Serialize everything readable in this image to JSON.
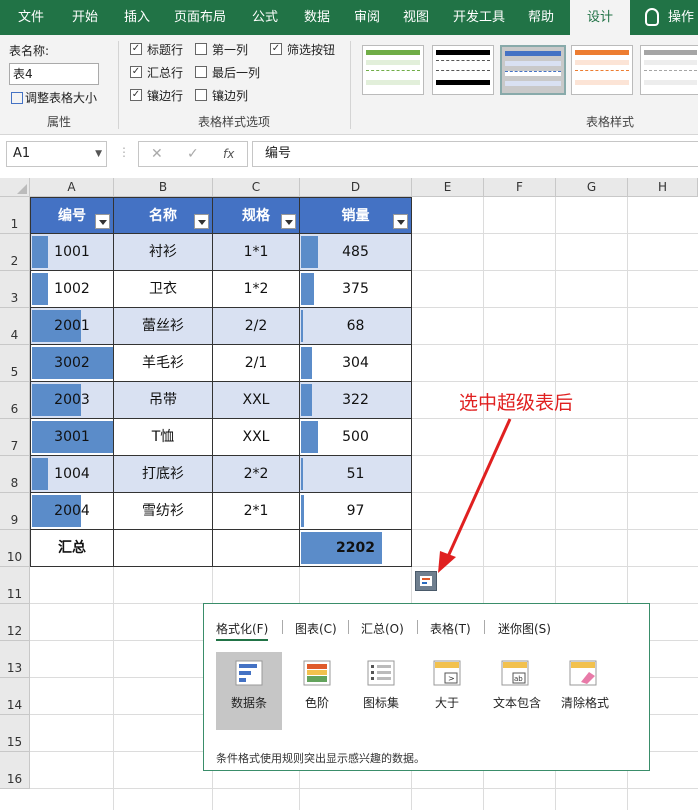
{
  "ribbon": {
    "tabs": [
      "文件",
      "开始",
      "插入",
      "页面布局",
      "公式",
      "数据",
      "审阅",
      "视图",
      "开发工具",
      "帮助",
      "设计",
      "操作"
    ],
    "active_tab": "设计",
    "properties": {
      "name_label": "表名称:",
      "name_value": "表4",
      "resize_label": "调整表格大小",
      "group_label": "属性"
    },
    "style_options": {
      "header_row": "标题行",
      "total_row": "汇总行",
      "banded_rows": "镶边行",
      "first_column": "第一列",
      "last_column": "最后一列",
      "banded_columns": "镶边列",
      "filter_button": "筛选按钮",
      "group_label": "表格样式选项",
      "header_row_checked": true,
      "total_row_checked": true,
      "banded_rows_checked": true,
      "first_column_checked": false,
      "last_column_checked": false,
      "banded_columns_checked": false,
      "filter_button_checked": true
    },
    "table_styles": {
      "group_label": "表格样式",
      "swatches": [
        "#70ad47",
        "#000000",
        "#4472c4",
        "#ed7d31",
        "#a5a5a5"
      ]
    }
  },
  "formula_bar": {
    "cell_ref": "A1",
    "cancel_glyph": "✕",
    "enter_glyph": "✓",
    "fx_glyph": "fx",
    "content": "编号"
  },
  "grid": {
    "columns": [
      "A",
      "B",
      "C",
      "D",
      "E",
      "F",
      "G",
      "H"
    ],
    "rows": [
      "1",
      "2",
      "3",
      "4",
      "5",
      "6",
      "7",
      "8",
      "9",
      "10",
      "11",
      "12",
      "13",
      "14",
      "15",
      "16"
    ]
  },
  "table": {
    "headers": [
      "编号",
      "名称",
      "规格",
      "销量"
    ],
    "rows": [
      {
        "id": "1001",
        "name": "衬衫",
        "spec": "1*1",
        "sales": "485"
      },
      {
        "id": "1002",
        "name": "卫衣",
        "spec": "1*2",
        "sales": "375"
      },
      {
        "id": "2001",
        "name": "蕾丝衫",
        "spec": "2/2",
        "sales": "68"
      },
      {
        "id": "3002",
        "name": "羊毛衫",
        "spec": "2/1",
        "sales": "304"
      },
      {
        "id": "2003",
        "name": "吊带",
        "spec": "XXL",
        "sales": "322"
      },
      {
        "id": "3001",
        "name": "T恤",
        "spec": "XXL",
        "sales": "500"
      },
      {
        "id": "1004",
        "name": "打底衫",
        "spec": "2*2",
        "sales": "51"
      },
      {
        "id": "2004",
        "name": "雪纺衫",
        "spec": "2*1",
        "sales": "97"
      }
    ],
    "total_label": "汇总",
    "total_value": "2202",
    "bar_color": "#5b8cc9"
  },
  "annotation": "选中超级表后",
  "quick_analysis": {
    "tabs": [
      "格式化(F)",
      "图表(C)",
      "汇总(O)",
      "表格(T)",
      "迷你图(S)"
    ],
    "items": [
      "数据条",
      "色阶",
      "图标集",
      "大于",
      "文本包含",
      "清除格式"
    ],
    "selected_item": "数据条",
    "description": "条件格式使用规则突出显示感兴趣的数据。"
  }
}
